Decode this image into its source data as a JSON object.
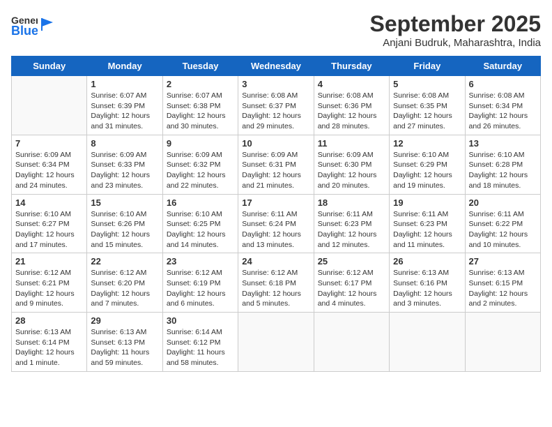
{
  "header": {
    "logo_general": "General",
    "logo_blue": "Blue",
    "month_year": "September 2025",
    "location": "Anjani Budruk, Maharashtra, India"
  },
  "days_of_week": [
    "Sunday",
    "Monday",
    "Tuesday",
    "Wednesday",
    "Thursday",
    "Friday",
    "Saturday"
  ],
  "weeks": [
    [
      {
        "day": "",
        "info": ""
      },
      {
        "day": "1",
        "info": "Sunrise: 6:07 AM\nSunset: 6:39 PM\nDaylight: 12 hours\nand 31 minutes."
      },
      {
        "day": "2",
        "info": "Sunrise: 6:07 AM\nSunset: 6:38 PM\nDaylight: 12 hours\nand 30 minutes."
      },
      {
        "day": "3",
        "info": "Sunrise: 6:08 AM\nSunset: 6:37 PM\nDaylight: 12 hours\nand 29 minutes."
      },
      {
        "day": "4",
        "info": "Sunrise: 6:08 AM\nSunset: 6:36 PM\nDaylight: 12 hours\nand 28 minutes."
      },
      {
        "day": "5",
        "info": "Sunrise: 6:08 AM\nSunset: 6:35 PM\nDaylight: 12 hours\nand 27 minutes."
      },
      {
        "day": "6",
        "info": "Sunrise: 6:08 AM\nSunset: 6:34 PM\nDaylight: 12 hours\nand 26 minutes."
      }
    ],
    [
      {
        "day": "7",
        "info": "Sunrise: 6:09 AM\nSunset: 6:34 PM\nDaylight: 12 hours\nand 24 minutes."
      },
      {
        "day": "8",
        "info": "Sunrise: 6:09 AM\nSunset: 6:33 PM\nDaylight: 12 hours\nand 23 minutes."
      },
      {
        "day": "9",
        "info": "Sunrise: 6:09 AM\nSunset: 6:32 PM\nDaylight: 12 hours\nand 22 minutes."
      },
      {
        "day": "10",
        "info": "Sunrise: 6:09 AM\nSunset: 6:31 PM\nDaylight: 12 hours\nand 21 minutes."
      },
      {
        "day": "11",
        "info": "Sunrise: 6:09 AM\nSunset: 6:30 PM\nDaylight: 12 hours\nand 20 minutes."
      },
      {
        "day": "12",
        "info": "Sunrise: 6:10 AM\nSunset: 6:29 PM\nDaylight: 12 hours\nand 19 minutes."
      },
      {
        "day": "13",
        "info": "Sunrise: 6:10 AM\nSunset: 6:28 PM\nDaylight: 12 hours\nand 18 minutes."
      }
    ],
    [
      {
        "day": "14",
        "info": "Sunrise: 6:10 AM\nSunset: 6:27 PM\nDaylight: 12 hours\nand 17 minutes."
      },
      {
        "day": "15",
        "info": "Sunrise: 6:10 AM\nSunset: 6:26 PM\nDaylight: 12 hours\nand 15 minutes."
      },
      {
        "day": "16",
        "info": "Sunrise: 6:10 AM\nSunset: 6:25 PM\nDaylight: 12 hours\nand 14 minutes."
      },
      {
        "day": "17",
        "info": "Sunrise: 6:11 AM\nSunset: 6:24 PM\nDaylight: 12 hours\nand 13 minutes."
      },
      {
        "day": "18",
        "info": "Sunrise: 6:11 AM\nSunset: 6:23 PM\nDaylight: 12 hours\nand 12 minutes."
      },
      {
        "day": "19",
        "info": "Sunrise: 6:11 AM\nSunset: 6:23 PM\nDaylight: 12 hours\nand 11 minutes."
      },
      {
        "day": "20",
        "info": "Sunrise: 6:11 AM\nSunset: 6:22 PM\nDaylight: 12 hours\nand 10 minutes."
      }
    ],
    [
      {
        "day": "21",
        "info": "Sunrise: 6:12 AM\nSunset: 6:21 PM\nDaylight: 12 hours\nand 9 minutes."
      },
      {
        "day": "22",
        "info": "Sunrise: 6:12 AM\nSunset: 6:20 PM\nDaylight: 12 hours\nand 7 minutes."
      },
      {
        "day": "23",
        "info": "Sunrise: 6:12 AM\nSunset: 6:19 PM\nDaylight: 12 hours\nand 6 minutes."
      },
      {
        "day": "24",
        "info": "Sunrise: 6:12 AM\nSunset: 6:18 PM\nDaylight: 12 hours\nand 5 minutes."
      },
      {
        "day": "25",
        "info": "Sunrise: 6:12 AM\nSunset: 6:17 PM\nDaylight: 12 hours\nand 4 minutes."
      },
      {
        "day": "26",
        "info": "Sunrise: 6:13 AM\nSunset: 6:16 PM\nDaylight: 12 hours\nand 3 minutes."
      },
      {
        "day": "27",
        "info": "Sunrise: 6:13 AM\nSunset: 6:15 PM\nDaylight: 12 hours\nand 2 minutes."
      }
    ],
    [
      {
        "day": "28",
        "info": "Sunrise: 6:13 AM\nSunset: 6:14 PM\nDaylight: 12 hours\nand 1 minute."
      },
      {
        "day": "29",
        "info": "Sunrise: 6:13 AM\nSunset: 6:13 PM\nDaylight: 11 hours\nand 59 minutes."
      },
      {
        "day": "30",
        "info": "Sunrise: 6:14 AM\nSunset: 6:12 PM\nDaylight: 11 hours\nand 58 minutes."
      },
      {
        "day": "",
        "info": ""
      },
      {
        "day": "",
        "info": ""
      },
      {
        "day": "",
        "info": ""
      },
      {
        "day": "",
        "info": ""
      }
    ]
  ]
}
